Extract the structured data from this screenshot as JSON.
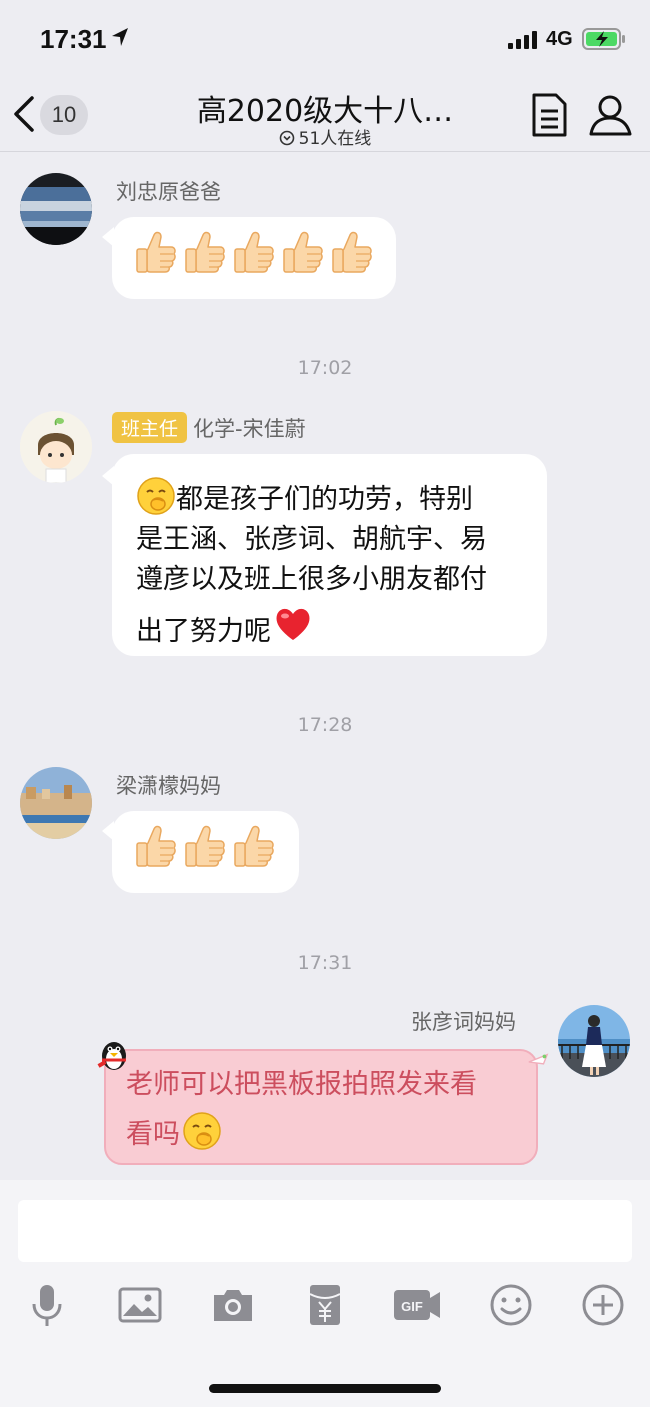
{
  "status_bar": {
    "time": "17:31",
    "network": "4G",
    "icons": [
      "location-arrow-icon",
      "signal-icon",
      "battery-charging-icon"
    ]
  },
  "nav": {
    "back_count": "10",
    "title": "高2020级大十八…",
    "online": "51人在线",
    "icons": [
      "back-chevron-icon",
      "online-status-icon",
      "document-icon",
      "group-members-icon"
    ]
  },
  "messages": [
    {
      "sender": "刘忠原爸爸",
      "content": "👍👍👍👍👍",
      "thumbs_count": 5
    },
    {
      "timestamp": "17:02"
    },
    {
      "sender_tag": "班主任",
      "sender": "化学-宋佳蔚",
      "lines": [
        "都是孩子们的功劳，特别",
        "是王涵、张彦词、胡航宇、易",
        "遵彦以及班上很多小朋友都付",
        "出了努力呢"
      ],
      "emojis": [
        "shy-face-emoji",
        "red-heart-emoji"
      ]
    },
    {
      "timestamp": "17:28"
    },
    {
      "sender": "梁潇檬妈妈",
      "content": "👍👍👍",
      "thumbs_count": 3
    },
    {
      "timestamp": "17:31"
    },
    {
      "sender": "张彦词妈妈",
      "lines": [
        "老师可以把黑板报拍照发来看",
        "看吗"
      ],
      "emojis": [
        "shy-face-emoji"
      ],
      "bubble_style": "pink-penguin"
    }
  ],
  "input": {
    "placeholder": "",
    "tools": [
      "microphone-icon",
      "image-icon",
      "camera-icon",
      "red-packet-icon",
      "gif-icon",
      "emoji-icon",
      "plus-icon"
    ]
  },
  "colors": {
    "background": "#ededf2",
    "bubble": "#ffffff",
    "tag": "#f0c343",
    "pink_bubble": "#f9ccd3",
    "pink_text": "#cc4e5e",
    "timestamp": "#a0a0a6"
  }
}
